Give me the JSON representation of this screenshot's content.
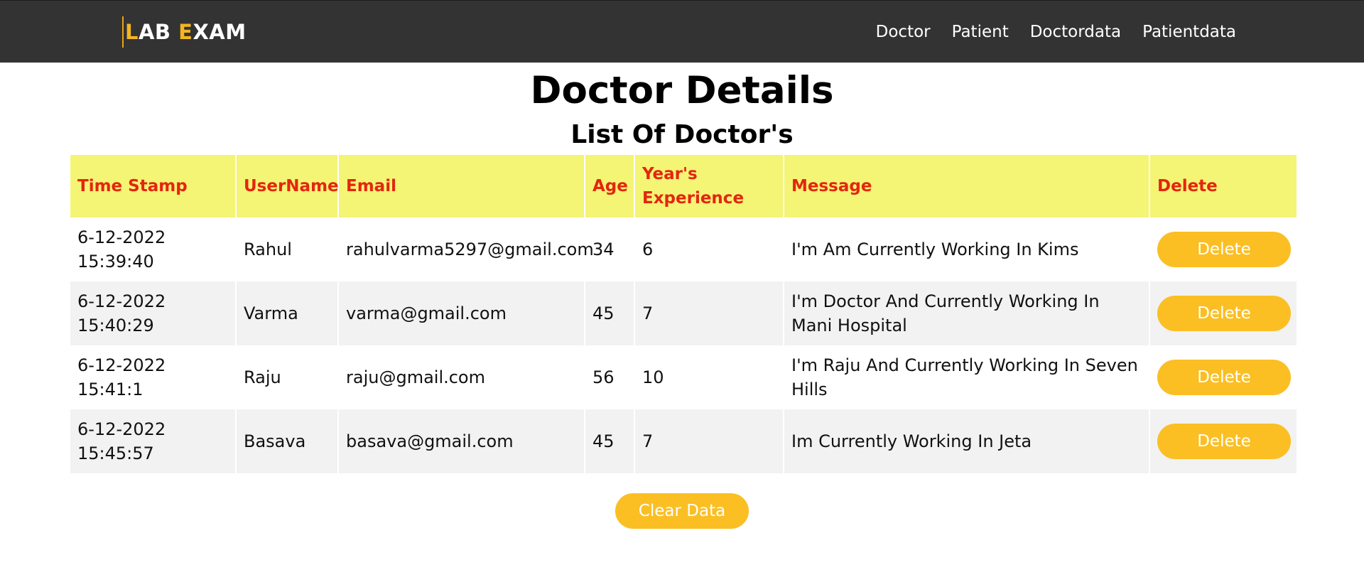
{
  "brand": {
    "first_letter": "L",
    "text1": "AB ",
    "second_letter": "E",
    "text2": "XAM"
  },
  "nav": {
    "links": [
      "Doctor",
      "Patient",
      "Doctordata",
      "Patientdata"
    ]
  },
  "page": {
    "title": "Doctor Details",
    "subtitle": "List Of Doctor's"
  },
  "table": {
    "headers": [
      "Time Stamp",
      "UserName",
      "Email",
      "Age",
      "Year's Experience",
      "Message",
      "Delete"
    ],
    "rows": [
      {
        "timestamp": "6-12-2022 15:39:40",
        "username": "Rahul",
        "email": "rahulvarma5297@gmail.com",
        "age": "34",
        "experience": "6",
        "message": "I'm Am Currently Working In Kims",
        "delete_label": "Delete"
      },
      {
        "timestamp": "6-12-2022 15:40:29",
        "username": "Varma",
        "email": "varma@gmail.com",
        "age": "45",
        "experience": "7",
        "message": "I'm Doctor And Currently Working In Mani Hospital",
        "delete_label": "Delete"
      },
      {
        "timestamp": "6-12-2022 15:41:1",
        "username": "Raju",
        "email": "raju@gmail.com",
        "age": "56",
        "experience": "10",
        "message": "I'm Raju And Currently Working In Seven Hills",
        "delete_label": "Delete"
      },
      {
        "timestamp": "6-12-2022 15:45:57",
        "username": "Basava",
        "email": "basava@gmail.com",
        "age": "45",
        "experience": "7",
        "message": "Im Currently Working In Jeta",
        "delete_label": "Delete"
      }
    ]
  },
  "actions": {
    "clear_label": "Clear Data"
  },
  "colors": {
    "navbar": "#333333",
    "accent": "#fbbf24",
    "header_bg": "#f4f475",
    "header_text": "#e3260f"
  }
}
